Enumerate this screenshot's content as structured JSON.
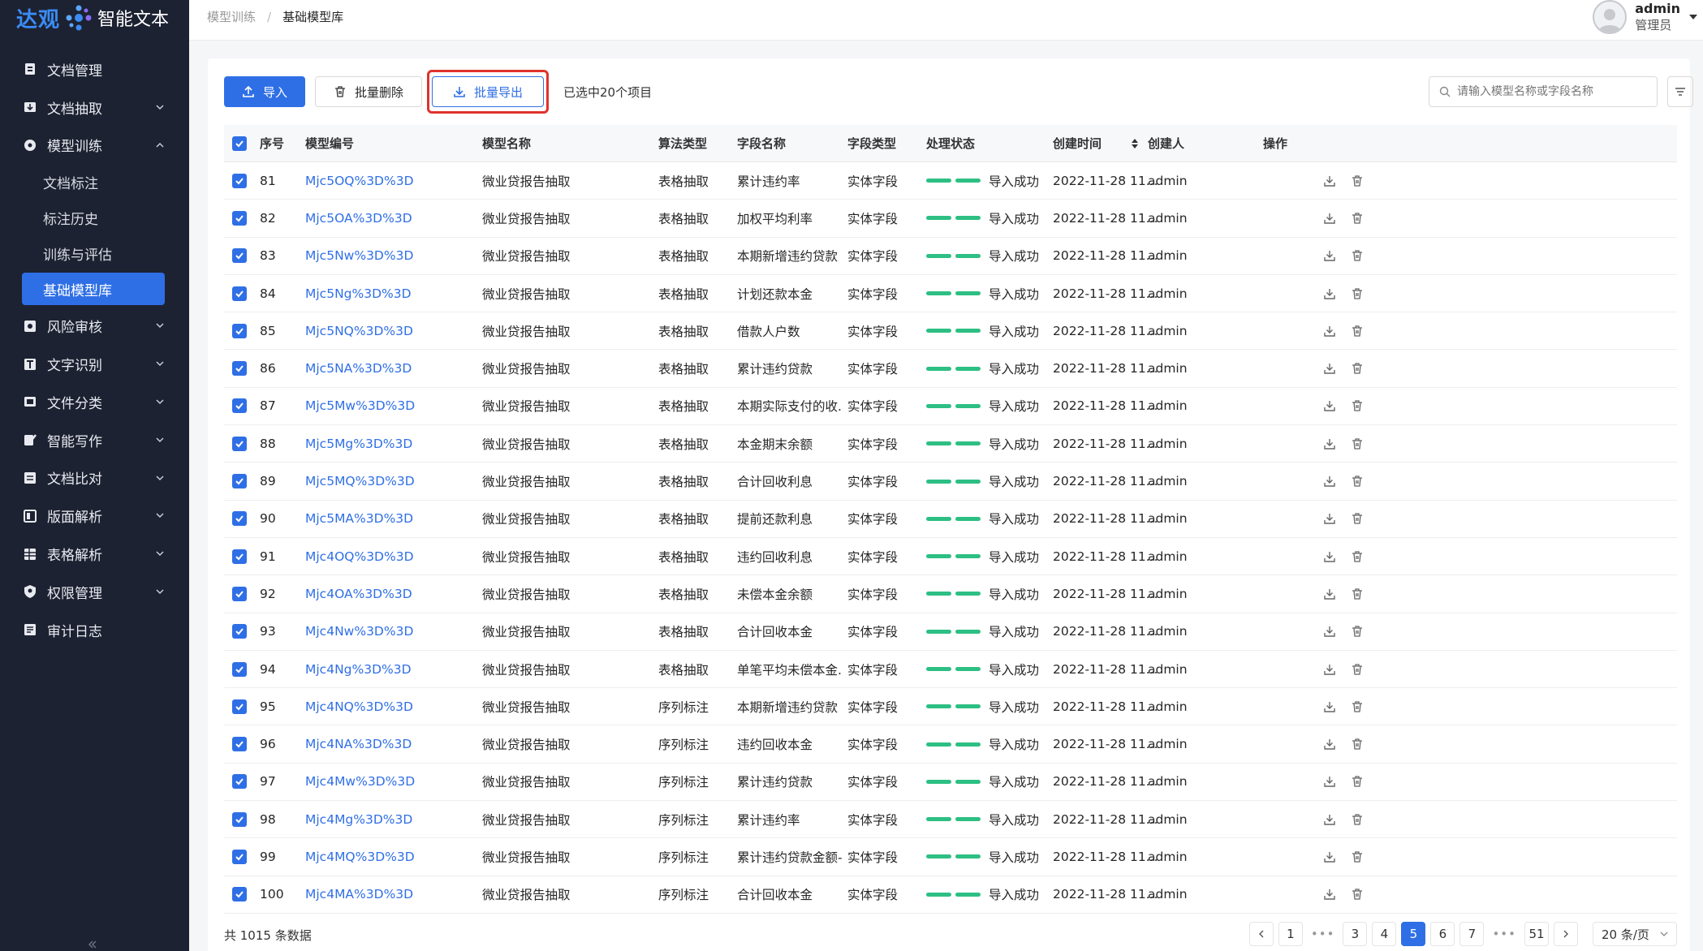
{
  "app": {
    "logo_main": "达观",
    "logo_sub": "智能文本"
  },
  "sidebar": {
    "items": [
      {
        "label": "文档管理",
        "icon": "document-icon",
        "chevron": ""
      },
      {
        "label": "文档抽取",
        "icon": "extract-icon",
        "chevron": "down"
      },
      {
        "label": "模型训练",
        "icon": "model-icon",
        "chevron": "up"
      },
      {
        "label": "风险审核",
        "icon": "risk-icon",
        "chevron": "down"
      },
      {
        "label": "文字识别",
        "icon": "text-icon",
        "chevron": "down"
      },
      {
        "label": "文件分类",
        "icon": "classify-icon",
        "chevron": "down"
      },
      {
        "label": "智能写作",
        "icon": "write-icon",
        "chevron": "down"
      },
      {
        "label": "文档比对",
        "icon": "compare-icon",
        "chevron": "down"
      },
      {
        "label": "版面解析",
        "icon": "layout-icon",
        "chevron": "down"
      },
      {
        "label": "表格解析",
        "icon": "table-icon",
        "chevron": "down"
      },
      {
        "label": "权限管理",
        "icon": "shield-icon",
        "chevron": "down"
      },
      {
        "label": "审计日志",
        "icon": "log-icon",
        "chevron": ""
      }
    ],
    "sub_items": [
      "文档标注",
      "标注历史",
      "训练与评估",
      "基础模型库"
    ],
    "active_sub": "基础模型库"
  },
  "breadcrumb": {
    "parent": "模型训练",
    "separator": "/",
    "current": "基础模型库"
  },
  "user": {
    "name": "admin",
    "role": "管理员"
  },
  "toolbar": {
    "import_label": "导入",
    "batch_delete_label": "批量删除",
    "batch_export_label": "批量导出",
    "selection_text": "已选中20个项目",
    "search_placeholder": "请输入模型名称或字段名称"
  },
  "table": {
    "columns": [
      "序号",
      "模型编号",
      "模型名称",
      "算法类型",
      "字段名称",
      "字段类型",
      "处理状态",
      "创建时间",
      "创建人",
      "操作"
    ],
    "rows": [
      [
        "81",
        "Mjc5OQ%3D%3D",
        "微业贷报告抽取",
        "表格抽取",
        "累计违约率",
        "实体字段",
        "导入成功",
        "2022-11-28 11...",
        "admin"
      ],
      [
        "82",
        "Mjc5OA%3D%3D",
        "微业贷报告抽取",
        "表格抽取",
        "加权平均利率",
        "实体字段",
        "导入成功",
        "2022-11-28 11...",
        "admin"
      ],
      [
        "83",
        "Mjc5Nw%3D%3D",
        "微业贷报告抽取",
        "表格抽取",
        "本期新增违约贷款",
        "实体字段",
        "导入成功",
        "2022-11-28 11...",
        "admin"
      ],
      [
        "84",
        "Mjc5Ng%3D%3D",
        "微业贷报告抽取",
        "表格抽取",
        "计划还款本金",
        "实体字段",
        "导入成功",
        "2022-11-28 11...",
        "admin"
      ],
      [
        "85",
        "Mjc5NQ%3D%3D",
        "微业贷报告抽取",
        "表格抽取",
        "借款人户数",
        "实体字段",
        "导入成功",
        "2022-11-28 11...",
        "admin"
      ],
      [
        "86",
        "Mjc5NA%3D%3D",
        "微业贷报告抽取",
        "表格抽取",
        "累计违约贷款",
        "实体字段",
        "导入成功",
        "2022-11-28 11...",
        "admin"
      ],
      [
        "87",
        "Mjc5Mw%3D%3D",
        "微业贷报告抽取",
        "表格抽取",
        "本期实际支付的收...",
        "实体字段",
        "导入成功",
        "2022-11-28 11...",
        "admin"
      ],
      [
        "88",
        "Mjc5Mg%3D%3D",
        "微业贷报告抽取",
        "表格抽取",
        "本金期末余额",
        "实体字段",
        "导入成功",
        "2022-11-28 11...",
        "admin"
      ],
      [
        "89",
        "Mjc5MQ%3D%3D",
        "微业贷报告抽取",
        "表格抽取",
        "合计回收利息",
        "实体字段",
        "导入成功",
        "2022-11-28 11...",
        "admin"
      ],
      [
        "90",
        "Mjc5MA%3D%3D",
        "微业贷报告抽取",
        "表格抽取",
        "提前还款利息",
        "实体字段",
        "导入成功",
        "2022-11-28 11...",
        "admin"
      ],
      [
        "91",
        "Mjc4OQ%3D%3D",
        "微业贷报告抽取",
        "表格抽取",
        "违约回收利息",
        "实体字段",
        "导入成功",
        "2022-11-28 11...",
        "admin"
      ],
      [
        "92",
        "Mjc4OA%3D%3D",
        "微业贷报告抽取",
        "表格抽取",
        "未偿本金余额",
        "实体字段",
        "导入成功",
        "2022-11-28 11...",
        "admin"
      ],
      [
        "93",
        "Mjc4Nw%3D%3D",
        "微业贷报告抽取",
        "表格抽取",
        "合计回收本金",
        "实体字段",
        "导入成功",
        "2022-11-28 11...",
        "admin"
      ],
      [
        "94",
        "Mjc4Ng%3D%3D",
        "微业贷报告抽取",
        "表格抽取",
        "单笔平均未偿本金...",
        "实体字段",
        "导入成功",
        "2022-11-28 11...",
        "admin"
      ],
      [
        "95",
        "Mjc4NQ%3D%3D",
        "微业贷报告抽取",
        "序列标注",
        "本期新增违约贷款",
        "实体字段",
        "导入成功",
        "2022-11-28 11...",
        "admin"
      ],
      [
        "96",
        "Mjc4NA%3D%3D",
        "微业贷报告抽取",
        "序列标注",
        "违约回收本金",
        "实体字段",
        "导入成功",
        "2022-11-28 11...",
        "admin"
      ],
      [
        "97",
        "Mjc4Mw%3D%3D",
        "微业贷报告抽取",
        "序列标注",
        "累计违约贷款",
        "实体字段",
        "导入成功",
        "2022-11-28 11...",
        "admin"
      ],
      [
        "98",
        "Mjc4Mg%3D%3D",
        "微业贷报告抽取",
        "序列标注",
        "累计违约率",
        "实体字段",
        "导入成功",
        "2022-11-28 11...",
        "admin"
      ],
      [
        "99",
        "Mjc4MQ%3D%3D",
        "微业贷报告抽取",
        "序列标注",
        "累计违约贷款金额-...",
        "实体字段",
        "导入成功",
        "2022-11-28 11...",
        "admin"
      ],
      [
        "100",
        "Mjc4MA%3D%3D",
        "微业贷报告抽取",
        "序列标注",
        "合计回收本金",
        "实体字段",
        "导入成功",
        "2022-11-28 11...",
        "admin"
      ]
    ]
  },
  "footer": {
    "total_text": "共 1015 条数据",
    "pages": [
      "1",
      "•••",
      "3",
      "4",
      "5",
      "6",
      "7",
      "•••",
      "51"
    ],
    "current_page": "5",
    "page_size": "20 条/页"
  },
  "colors": {
    "primary": "#2f6fe6",
    "sidebar_bg": "#1d2232",
    "success": "#2dbf83",
    "highlight": "#e0322b"
  }
}
